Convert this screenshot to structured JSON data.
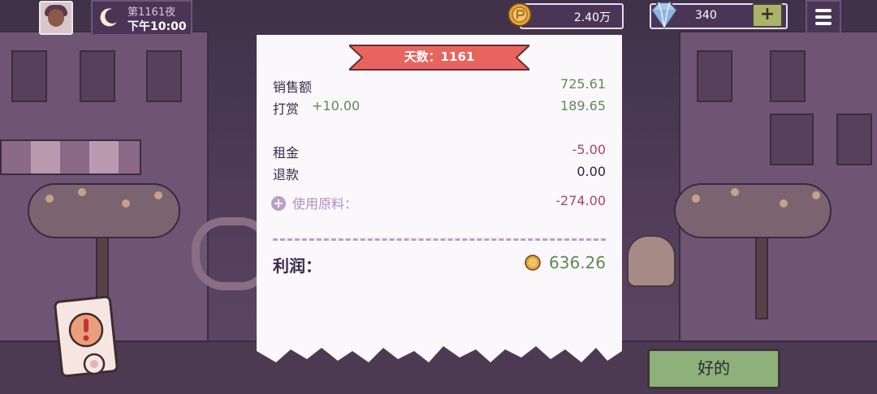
{
  "hud": {
    "day_label": "第1161夜",
    "time_label": "下午10:00",
    "coins": "2.40万",
    "gems": "340",
    "gem_plus": "+",
    "coin_icon": "coin-icon",
    "gem_icon": "diamond-icon",
    "menu_icon": "hamburger-menu-icon",
    "moon_icon": "moon-icon"
  },
  "receipt": {
    "banner": "天数：1161",
    "rows": [
      {
        "label": "销售额",
        "value": "725.61"
      },
      {
        "label": "打赏",
        "bonus": "+10.00",
        "value": "189.65"
      },
      {
        "label": "租金",
        "value": "-5.00"
      },
      {
        "label": "退款",
        "value": "0.00"
      },
      {
        "label": "使用原料：",
        "value": "-274.00"
      }
    ],
    "profit_label": "利润：",
    "profit_value": "636.26"
  },
  "buttons": {
    "ok": "好的"
  },
  "colors": {
    "positive": "#5f8a55",
    "negative": "#b0455a",
    "banner": "#e8655e",
    "ok_button": "#8eb07b",
    "hud_bg": "#4b3557"
  }
}
